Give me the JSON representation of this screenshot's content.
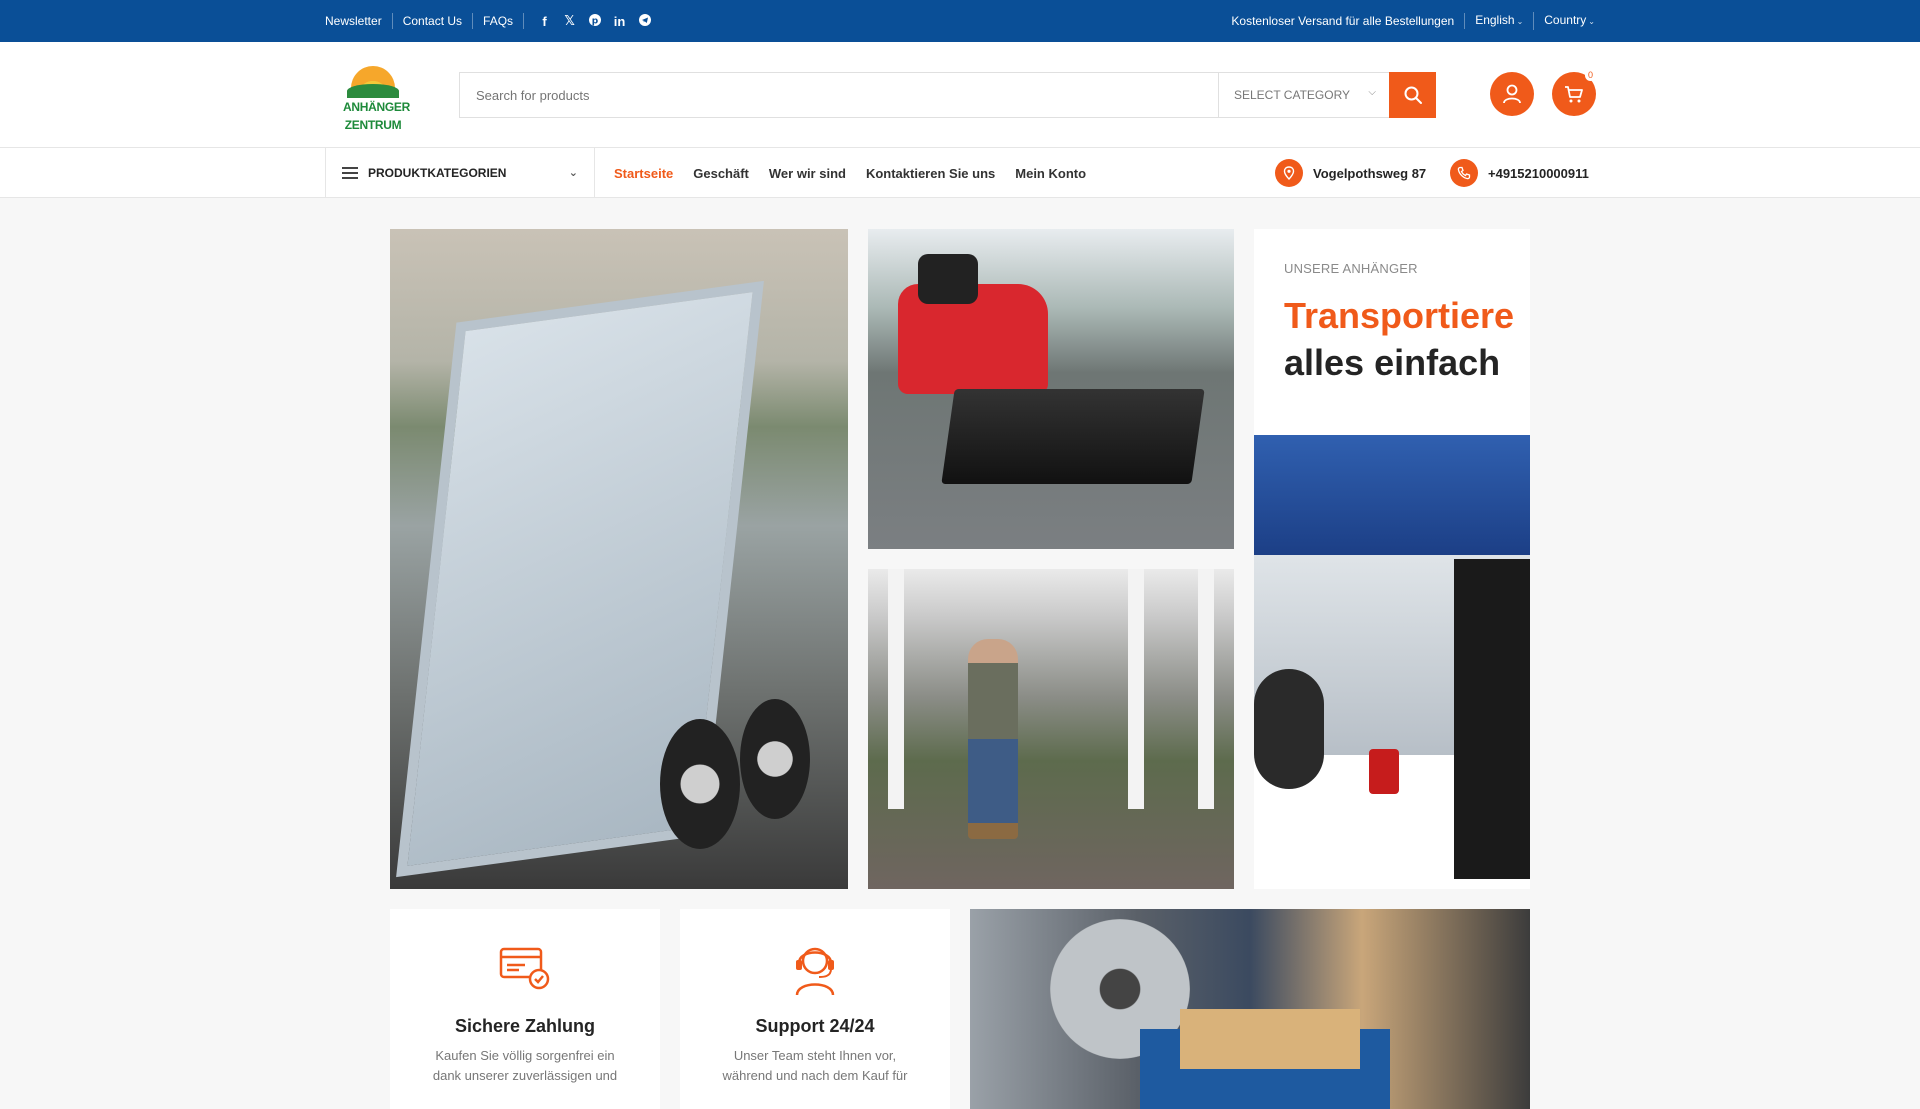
{
  "topbar": {
    "links": [
      "Newsletter",
      "Contact Us",
      "FAQs"
    ],
    "social": [
      "facebook-icon",
      "x-icon",
      "pinterest-icon",
      "linkedin-icon",
      "telegram-icon"
    ],
    "shipping": "Kostenloser Versand für alle Bestellungen",
    "language": "English",
    "country": "Country"
  },
  "logo": {
    "line1": "ANHÄNGER",
    "line2": "ZENTRUM"
  },
  "search": {
    "placeholder": "Search for products",
    "category": "SELECT CATEGORY"
  },
  "cart": {
    "count": "0"
  },
  "nav": {
    "categories_label": "PRODUKTKATEGORIEN",
    "items": [
      "Startseite",
      "Geschäft",
      "Wer wir sind",
      "Kontaktieren Sie uns",
      "Mein Konto"
    ],
    "active_index": 0,
    "address": "Vogelpothsweg 87",
    "phone": "+4915210000911"
  },
  "promo": {
    "subtitle": "UNSERE ANHÄNGER",
    "title_line1": "Transportiere",
    "title_line2": "alles einfach"
  },
  "features": [
    {
      "title": "Sichere Zahlung",
      "desc": "Kaufen Sie völlig sorgenfrei ein dank unserer zuverlässigen und",
      "icon": "secure-card-icon"
    },
    {
      "title": "Support 24/24",
      "desc": "Unser Team steht Ihnen vor, während und nach dem Kauf für",
      "icon": "support-headset-icon"
    }
  ],
  "colors": {
    "topbar": "#0a4f97",
    "accent": "#f05a1a"
  }
}
